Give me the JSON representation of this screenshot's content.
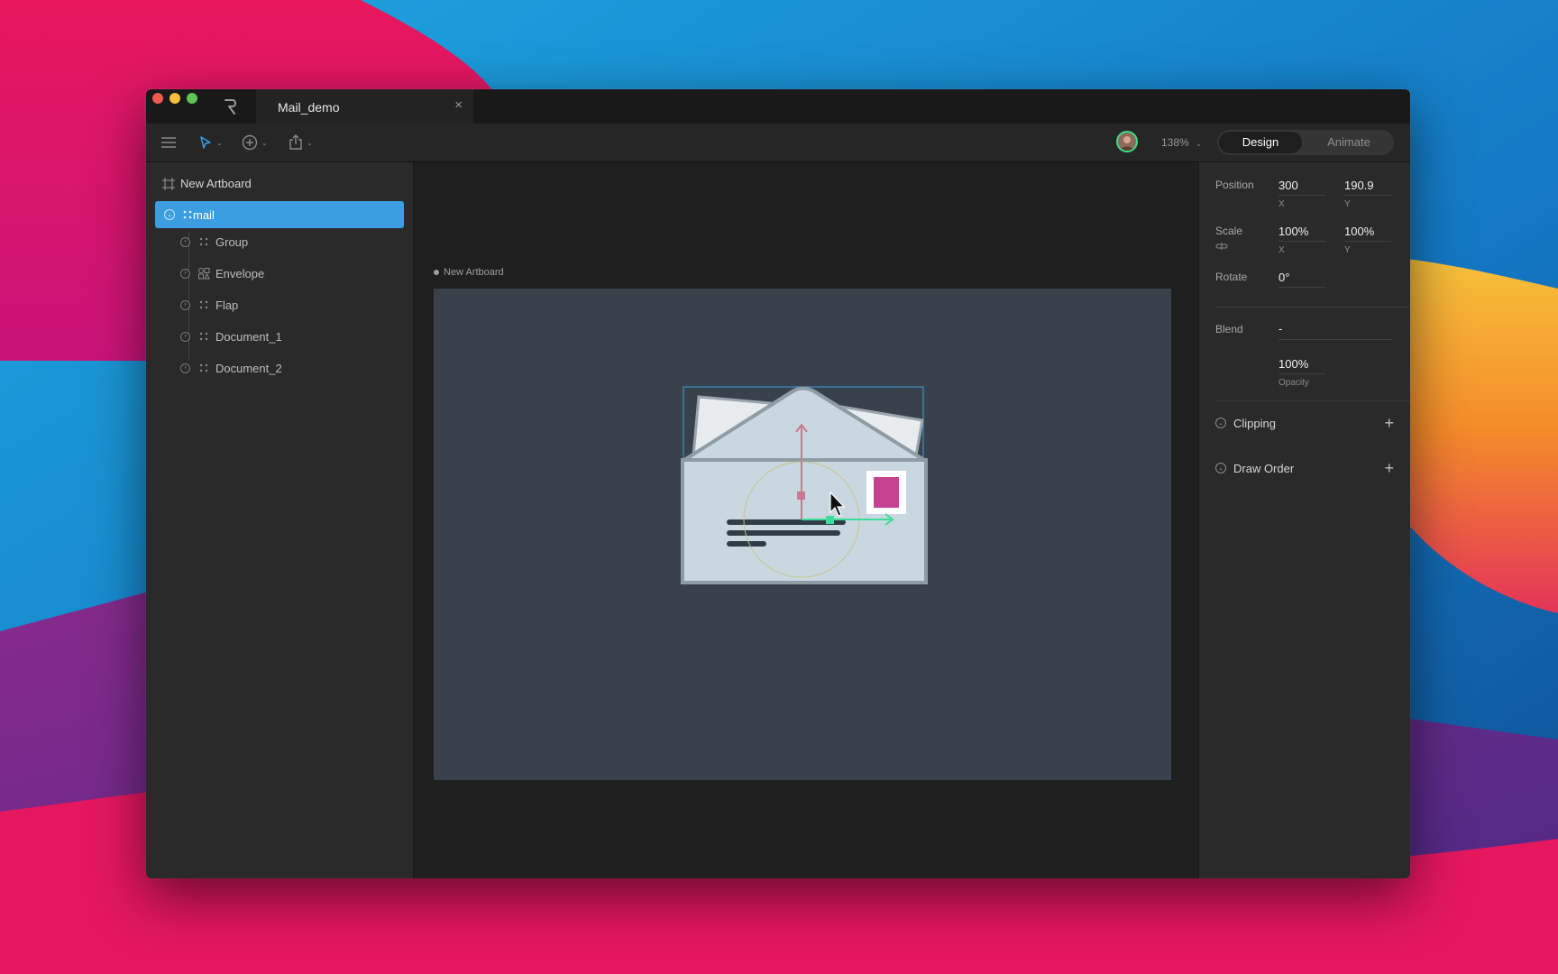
{
  "window": {
    "tab_title": "Mail_demo",
    "tab_close": "×"
  },
  "toolbar": {
    "zoom": "138%",
    "caret": "⌄",
    "mode_design": "Design",
    "mode_animate": "Animate"
  },
  "hierarchy": {
    "artboard": "New Artboard",
    "selected": "mail",
    "layers": [
      {
        "label": "Group",
        "icon": "bone-icon"
      },
      {
        "label": "Envelope",
        "icon": "shapes-icon"
      },
      {
        "label": "Flap",
        "icon": "bone-icon"
      },
      {
        "label": "Document_1",
        "icon": "bone-icon"
      },
      {
        "label": "Document_2",
        "icon": "bone-icon"
      }
    ]
  },
  "stage": {
    "artboard_label": "New Artboard"
  },
  "inspector": {
    "position_label": "Position",
    "position_x": "300",
    "position_y": "190.9",
    "x_label": "X",
    "y_label": "Y",
    "scale_label": "Scale",
    "scale_x": "100%",
    "scale_y": "100%",
    "rotate_label": "Rotate",
    "rotate_value": "0°",
    "blend_label": "Blend",
    "blend_value": "-",
    "opacity_value": "100%",
    "opacity_label": "Opacity",
    "clipping_label": "Clipping",
    "draw_order_label": "Draw Order",
    "add_symbol": "+"
  },
  "colors": {
    "selection_blue": "#3b9ee0",
    "artboard_bg": "#39424b",
    "stamp_pink": "#c6418f",
    "bone_green": "#3ddc84"
  }
}
